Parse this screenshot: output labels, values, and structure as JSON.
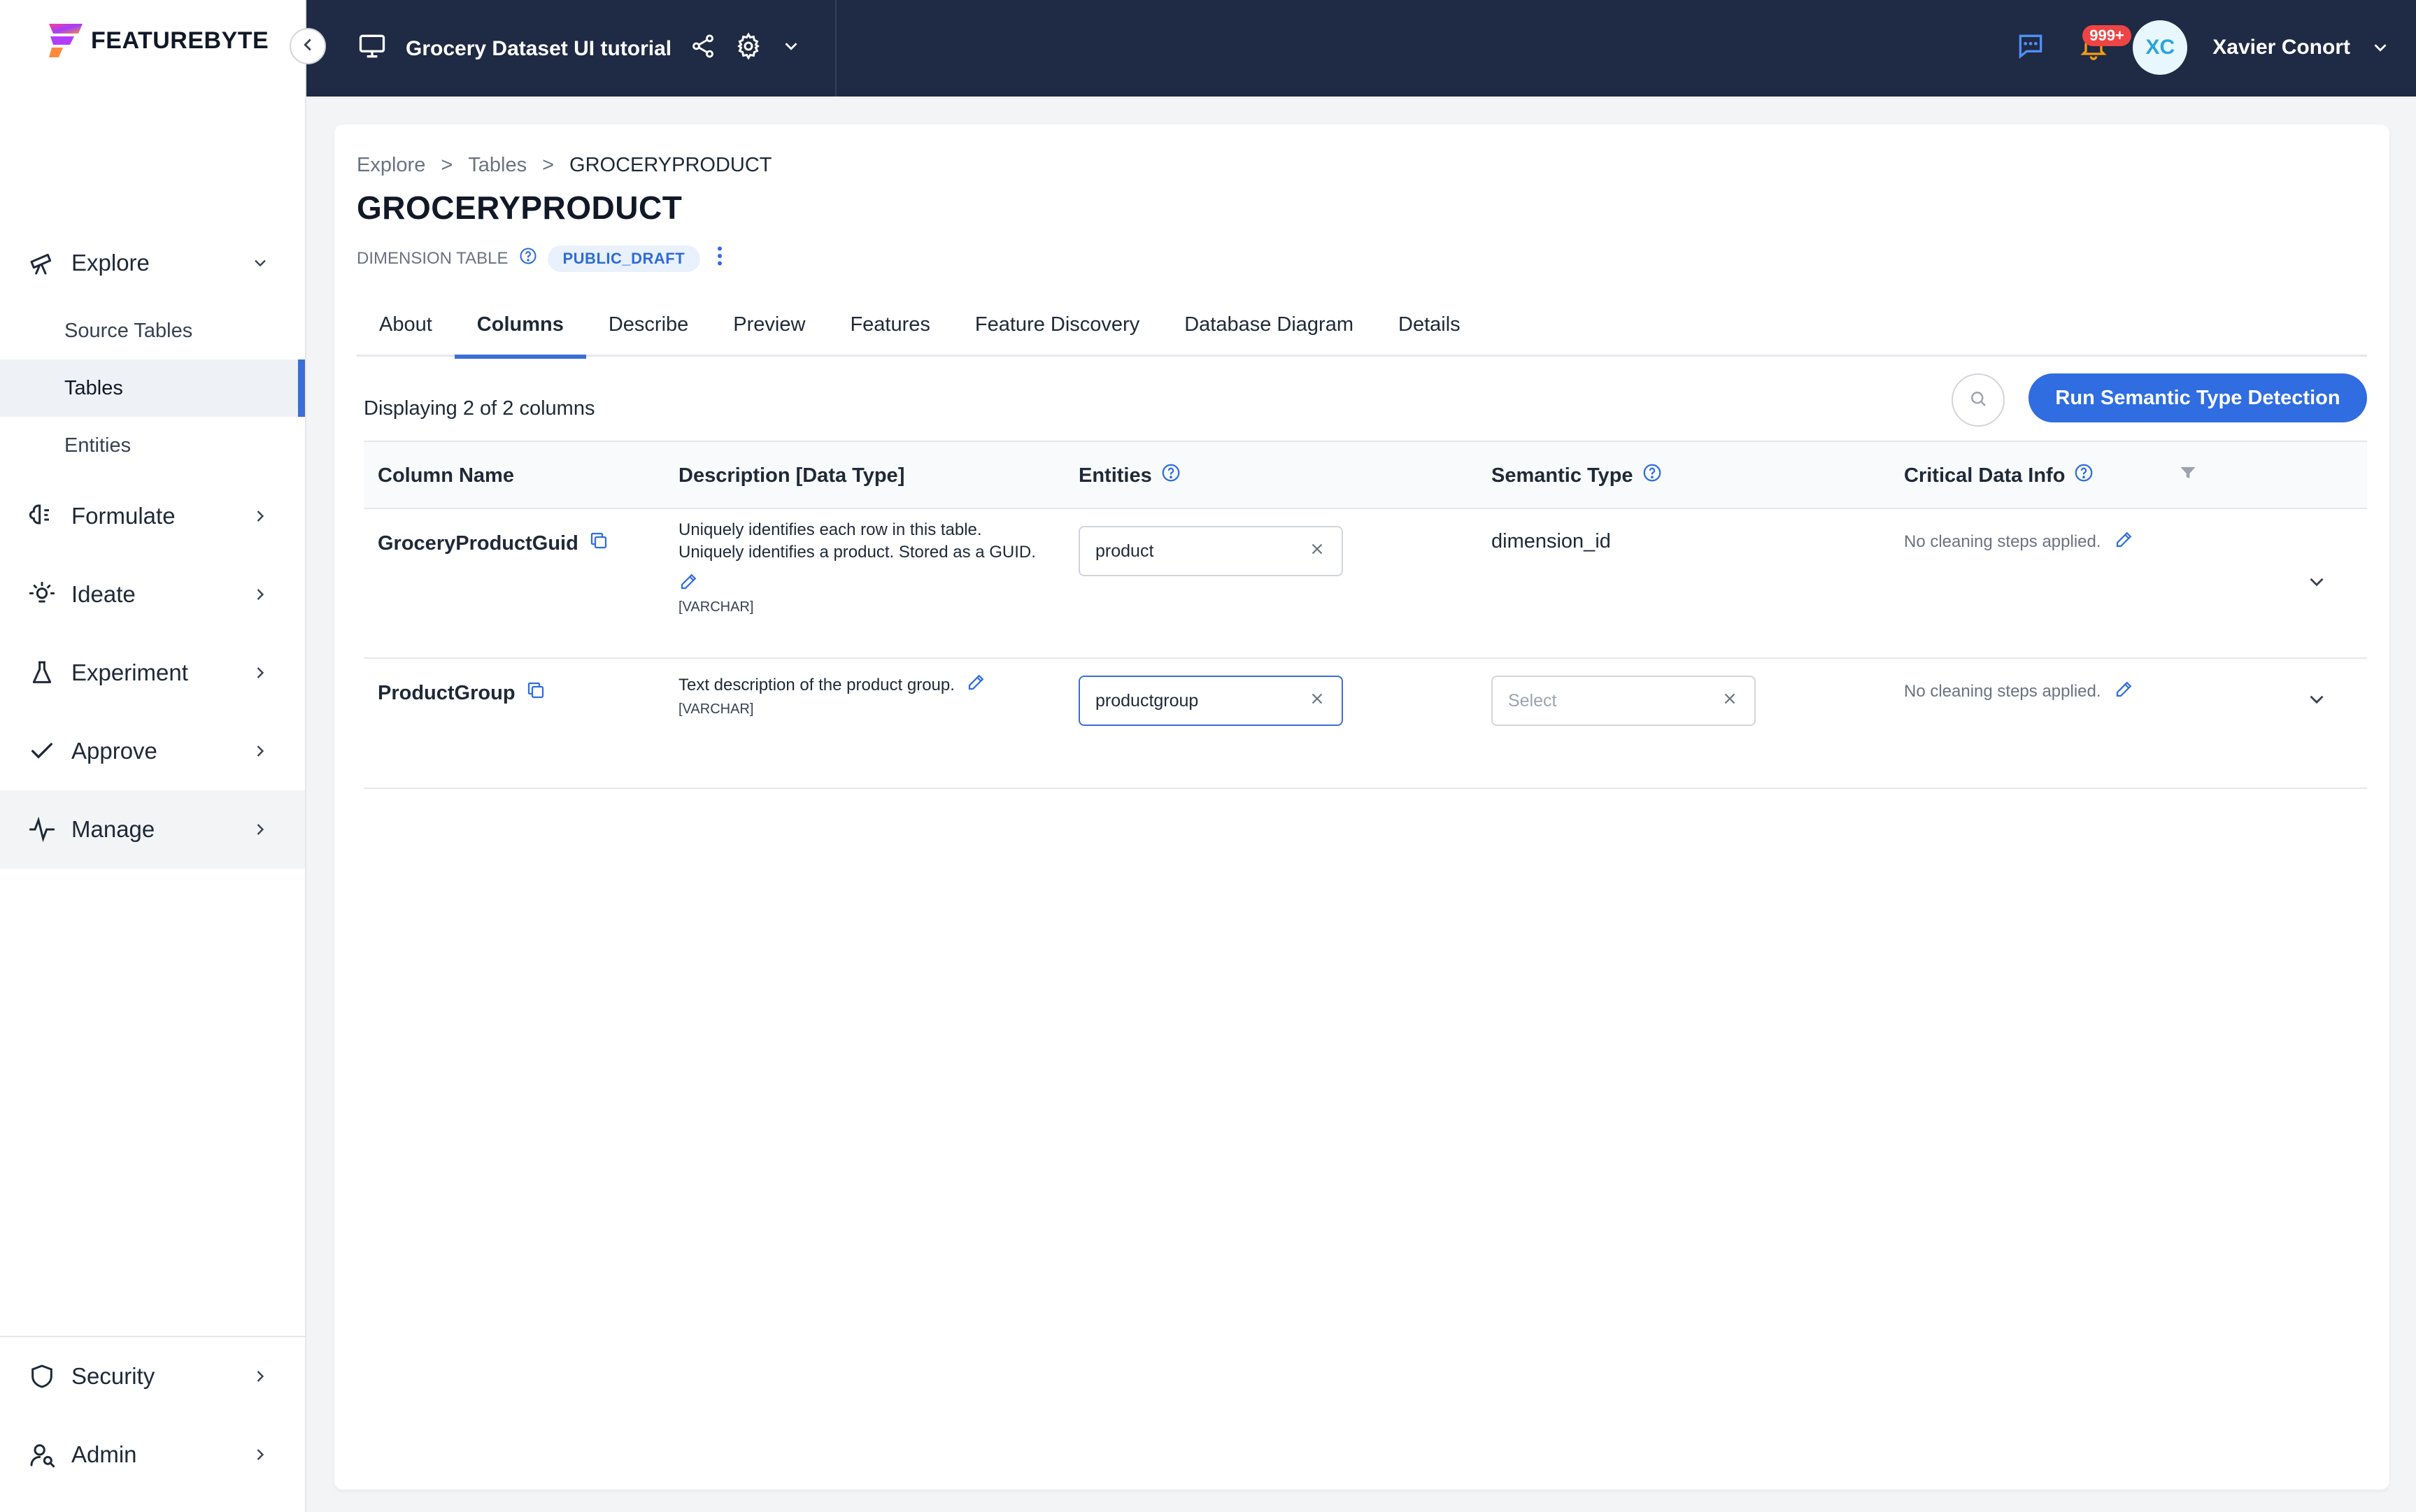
{
  "brand": {
    "name": "FEATUREBYTE"
  },
  "sidebar": {
    "explore": {
      "label": "Explore"
    },
    "sub_items": [
      {
        "label": "Source Tables"
      },
      {
        "label": "Tables"
      },
      {
        "label": "Entities"
      }
    ],
    "items": [
      {
        "label": "Formulate"
      },
      {
        "label": "Ideate"
      },
      {
        "label": "Experiment"
      },
      {
        "label": "Approve"
      },
      {
        "label": "Manage"
      }
    ],
    "bottom_items": [
      {
        "label": "Security"
      },
      {
        "label": "Admin"
      }
    ]
  },
  "topbar": {
    "project_name": "Grocery Dataset UI tutorial",
    "notification_count": "999+",
    "user_initials": "XC",
    "user_name": "Xavier Conort"
  },
  "breadcrumb": [
    "Explore",
    ">",
    "Tables",
    ">",
    "GROCERYPRODUCT"
  ],
  "page": {
    "title": "GROCERYPRODUCT",
    "table_type": "DIMENSION TABLE",
    "status": "PUBLIC_DRAFT"
  },
  "tabs": [
    {
      "label": "About"
    },
    {
      "label": "Columns"
    },
    {
      "label": "Describe"
    },
    {
      "label": "Preview"
    },
    {
      "label": "Features"
    },
    {
      "label": "Feature Discovery"
    },
    {
      "label": "Database Diagram"
    },
    {
      "label": "Details"
    }
  ],
  "active_tab": "Columns",
  "toolbar": {
    "displaying": "Displaying 2 of 2 columns",
    "run_button": "Run Semantic Type Detection"
  },
  "columns_table": {
    "headers": {
      "column_name": "Column Name",
      "description": "Description [Data Type]",
      "entities": "Entities",
      "semantic_type": "Semantic Type",
      "critical": "Critical Data Info"
    },
    "rows": [
      {
        "name": "GroceryProductGuid",
        "description": "Uniquely identifies each row in this table. Uniquely identifies a product. Stored as a GUID.",
        "dtype": "[VARCHAR]",
        "entity": "product",
        "semantic_type": "dimension_id",
        "critical": "No cleaning steps applied."
      },
      {
        "name": "ProductGroup",
        "description": "Text description of the product group.",
        "dtype": "[VARCHAR]",
        "entity": "productgroup",
        "semantic_placeholder": "Select",
        "critical": "No cleaning steps applied."
      }
    ]
  },
  "colors": {
    "topbar_bg": "#1f2a44",
    "accent": "#2f6de0",
    "badge": "#ef4444"
  }
}
